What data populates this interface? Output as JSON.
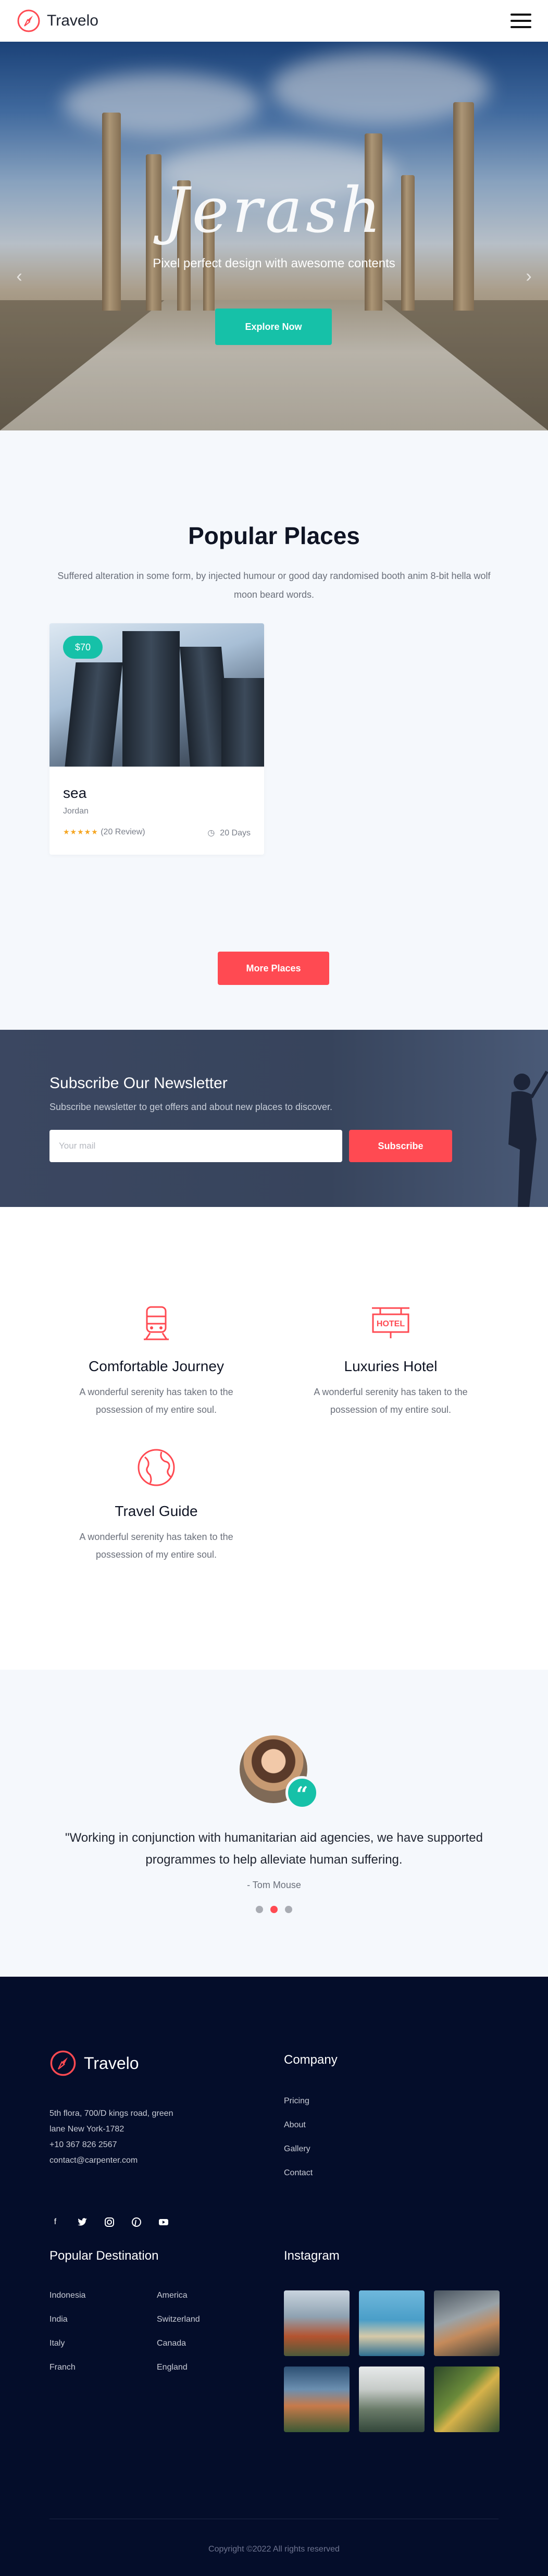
{
  "header": {
    "brand": "Travelo"
  },
  "hero": {
    "title": "Jerash",
    "subtitle": "Pixel perfect design with awesome contents",
    "button": "Explore Now"
  },
  "popular": {
    "title": "Popular Places",
    "description": "Suffered alteration in some form, by injected humour or good day randomised booth anim 8-bit hella wolf moon beard words.",
    "card": {
      "price": "$70",
      "name": "sea",
      "location": "Jordan",
      "reviews": "(20 Review)",
      "duration": "20 Days",
      "rating": 5
    },
    "more_button": "More Places"
  },
  "newsletter": {
    "title": "Subscribe Our Newsletter",
    "subtitle": "Subscribe newsletter to get offers and about new places to discover.",
    "input_placeholder": "Your mail",
    "button": "Subscribe"
  },
  "features": [
    {
      "icon": "train-icon",
      "title": "Comfortable Journey",
      "text": "A wonderful serenity has taken to the possession of my entire soul."
    },
    {
      "icon": "hotel-icon",
      "title": "Luxuries Hotel",
      "text": "A wonderful serenity has taken to the possession of my entire soul."
    },
    {
      "icon": "globe-icon",
      "title": "Travel Guide",
      "text": "A wonderful serenity has taken to the possession of my entire soul."
    }
  ],
  "testimonial": {
    "quote": "\"Working in conjunction with humanitarian aid agencies, we have supported programmes to help alleviate human suffering.",
    "author": "- Tom Mouse",
    "active_dot": 1
  },
  "footer": {
    "brand": "Travelo",
    "address_line1": "5th flora, 700/D kings road, green",
    "address_line2": "lane New York-1782",
    "phone": "+10 367 826 2567",
    "email": "contact@carpenter.com",
    "socials": [
      "facebook-icon",
      "twitter-icon",
      "instagram-icon",
      "pinterest-icon",
      "youtube-icon"
    ],
    "company_title": "Company",
    "company_links": [
      "Pricing",
      "About",
      "Gallery",
      "Contact"
    ],
    "destination_title": "Popular Destination",
    "destinations": [
      "Indonesia",
      "America",
      "India",
      "Switzerland",
      "Italy",
      "Canada",
      "Franch",
      "England"
    ],
    "instagram_title": "Instagram",
    "copyright": "Copyright ©2022 All rights reserved"
  },
  "colors": {
    "accent_teal": "#16c1a8",
    "accent_red": "#ff4a52",
    "footer_bg": "#040d2a"
  }
}
